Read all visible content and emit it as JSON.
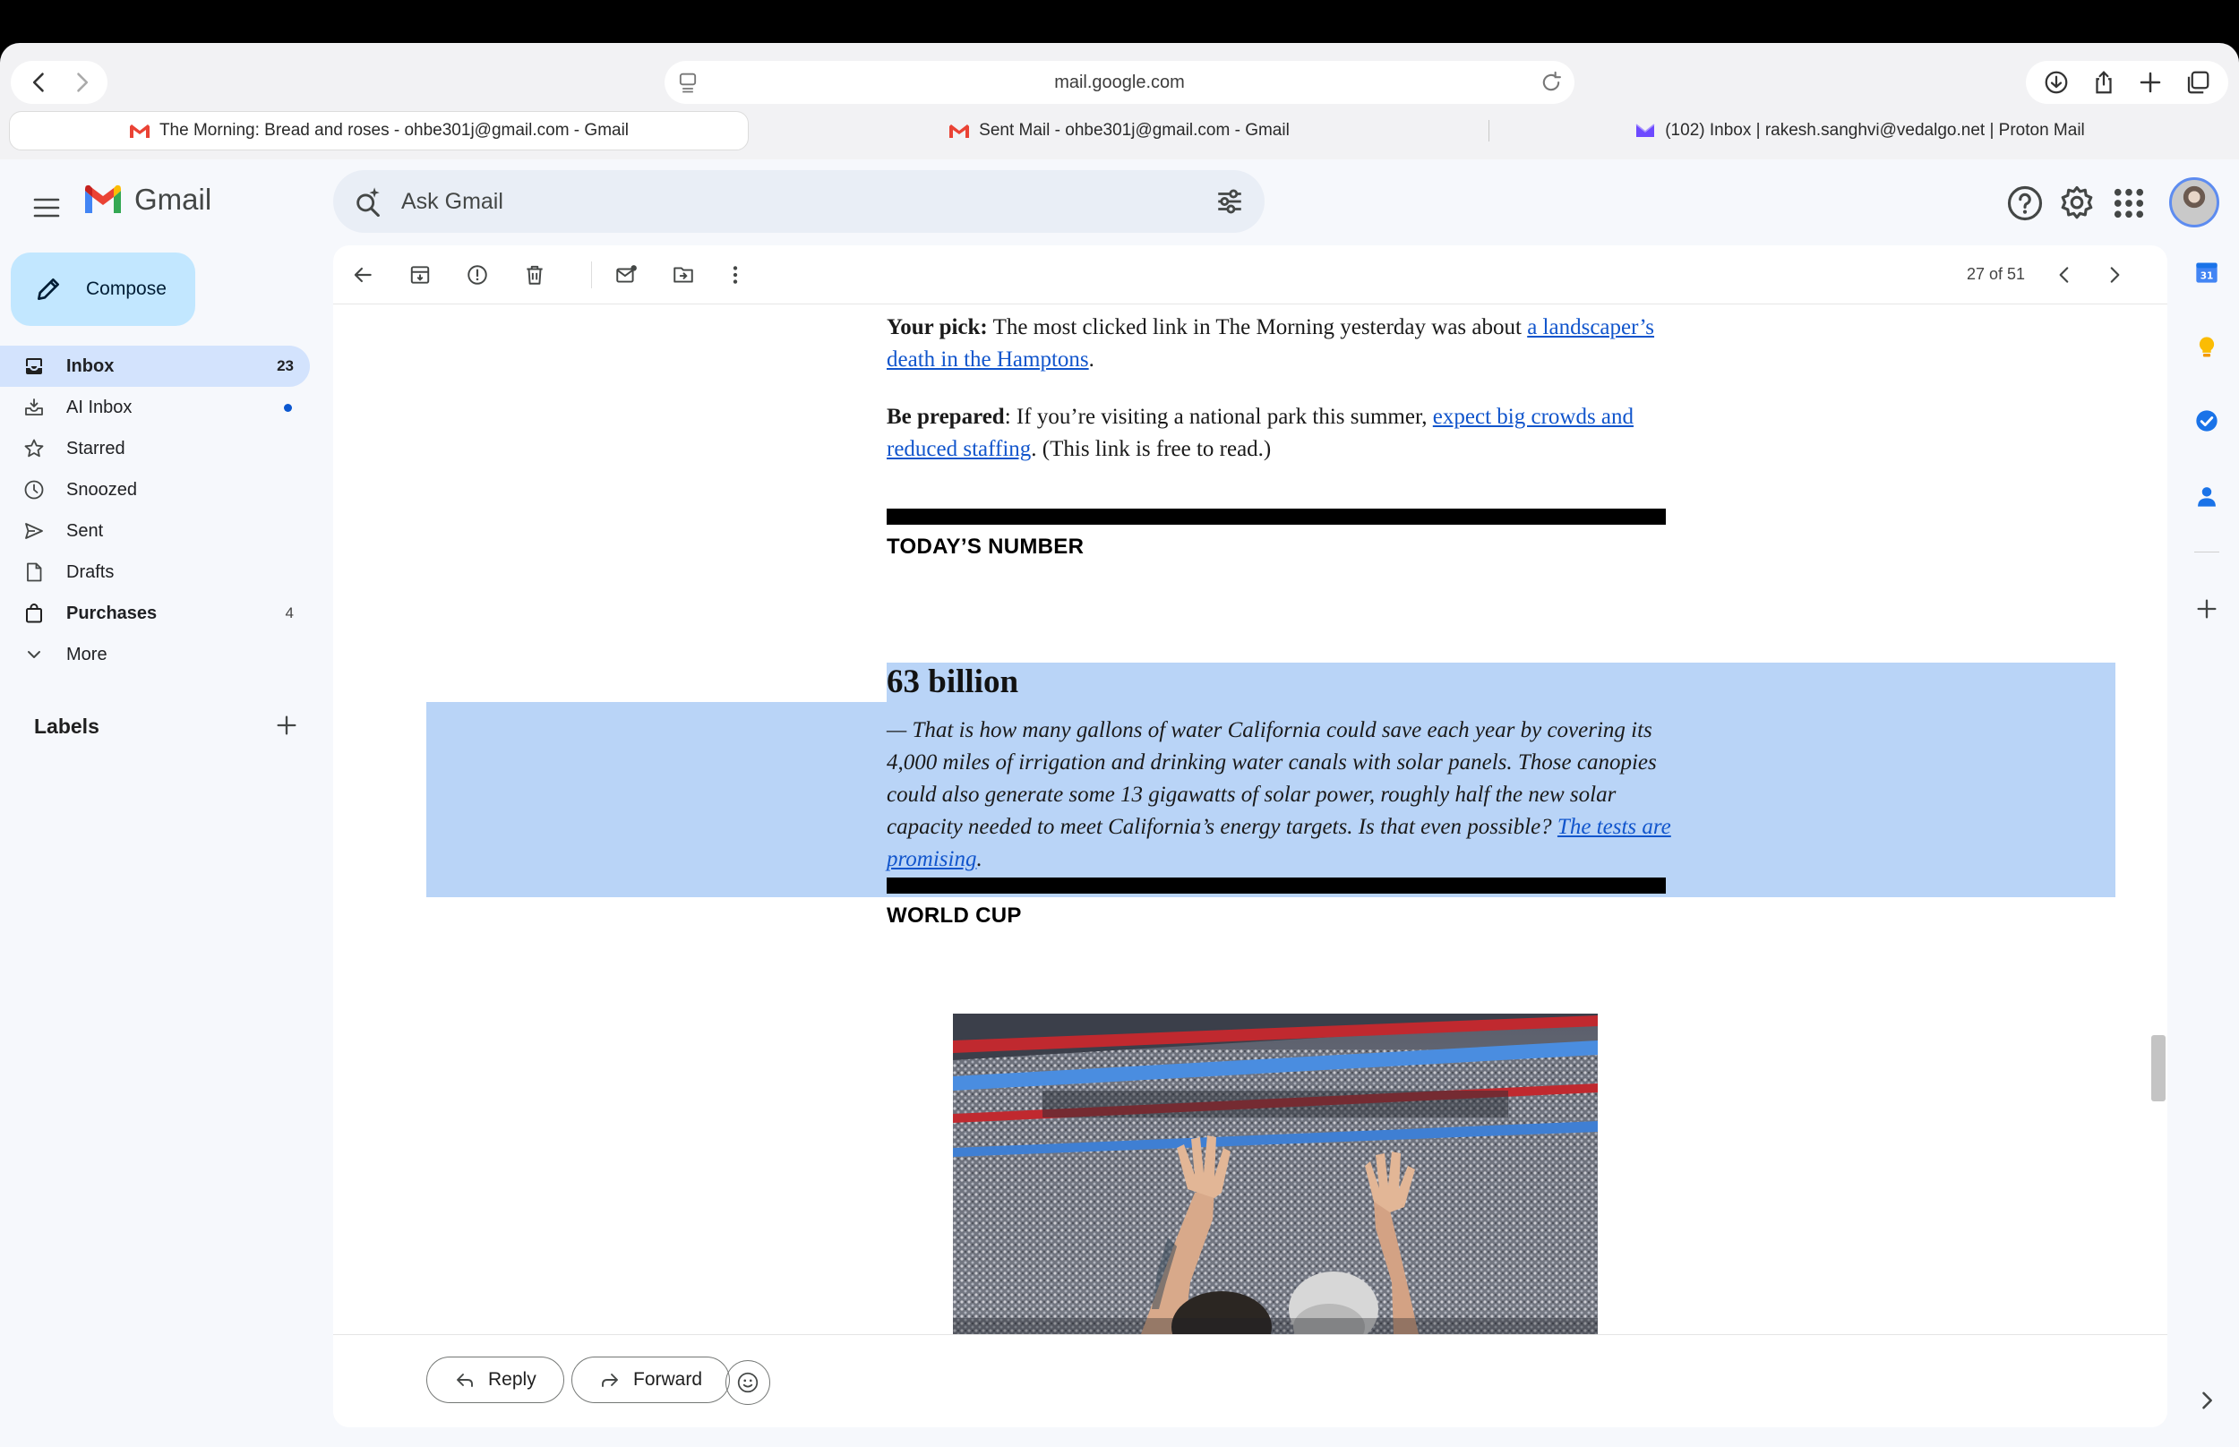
{
  "browser": {
    "url": "mail.google.com",
    "tabs": [
      {
        "title": "The Morning: Bread and roses - ohbe301j@gmail.com - Gmail",
        "icon": "gmail-icon",
        "active": true
      },
      {
        "title": "Sent Mail - ohbe301j@gmail.com - Gmail",
        "icon": "gmail-icon",
        "active": false
      },
      {
        "title": "(102) Inbox | rakesh.sanghvi@vedalgo.net | Proton Mail",
        "icon": "proton-mail-icon",
        "active": false
      }
    ]
  },
  "gmail": {
    "logo_text": "Gmail",
    "search": {
      "placeholder": "Ask Gmail"
    },
    "compose_label": "Compose",
    "nav": [
      {
        "label": "Inbox",
        "count": "23",
        "icon": "inbox-icon"
      },
      {
        "label": "AI Inbox",
        "icon": "ai-inbox-icon"
      },
      {
        "label": "Starred",
        "icon": "star-icon"
      },
      {
        "label": "Snoozed",
        "icon": "clock-icon"
      },
      {
        "label": "Sent",
        "icon": "send-icon"
      },
      {
        "label": "Drafts",
        "icon": "draft-icon"
      },
      {
        "label": "Purchases",
        "count": "4",
        "icon": "shopping-bag-icon"
      },
      {
        "label": "More",
        "icon": "chevron-down-icon"
      }
    ],
    "labels_heading": "Labels",
    "pager": "27 of 51",
    "accent": "#0b57d0",
    "compose_bg": "#c2e7ff",
    "selected_nav_bg": "#d3e3fd"
  },
  "email": {
    "your_pick": {
      "lead": "Your pick:",
      "text": " The most clicked link in The Morning yesterday was about ",
      "link": "a landscaper’s death in the Hamptons",
      "tail": "."
    },
    "be_prepared": {
      "lead": "Be prepared",
      "text": ": If you’re visiting a national park this summer, ",
      "link": "expect big crowds and reduced staffing",
      "tail": ". (This link is free to read.)"
    },
    "todays_number": {
      "heading": "TODAY’S NUMBER",
      "number": "63 billion",
      "text": "— That is how many gallons of water California could save each year by covering its 4,000 miles of irrigation and drinking water canals with solar panels. Those canopies could also generate some 13 gigawatts of solar power, roughly half the new solar capacity needed to meet California’s energy targets. Is that even possible? ",
      "link": "The tests are promising",
      "tail": "."
    },
    "world_cup": {
      "heading": "WORLD CUP"
    },
    "selection_color": "#b9d4f7"
  },
  "reply_bar": {
    "reply_label": "Reply",
    "forward_label": "Forward"
  }
}
